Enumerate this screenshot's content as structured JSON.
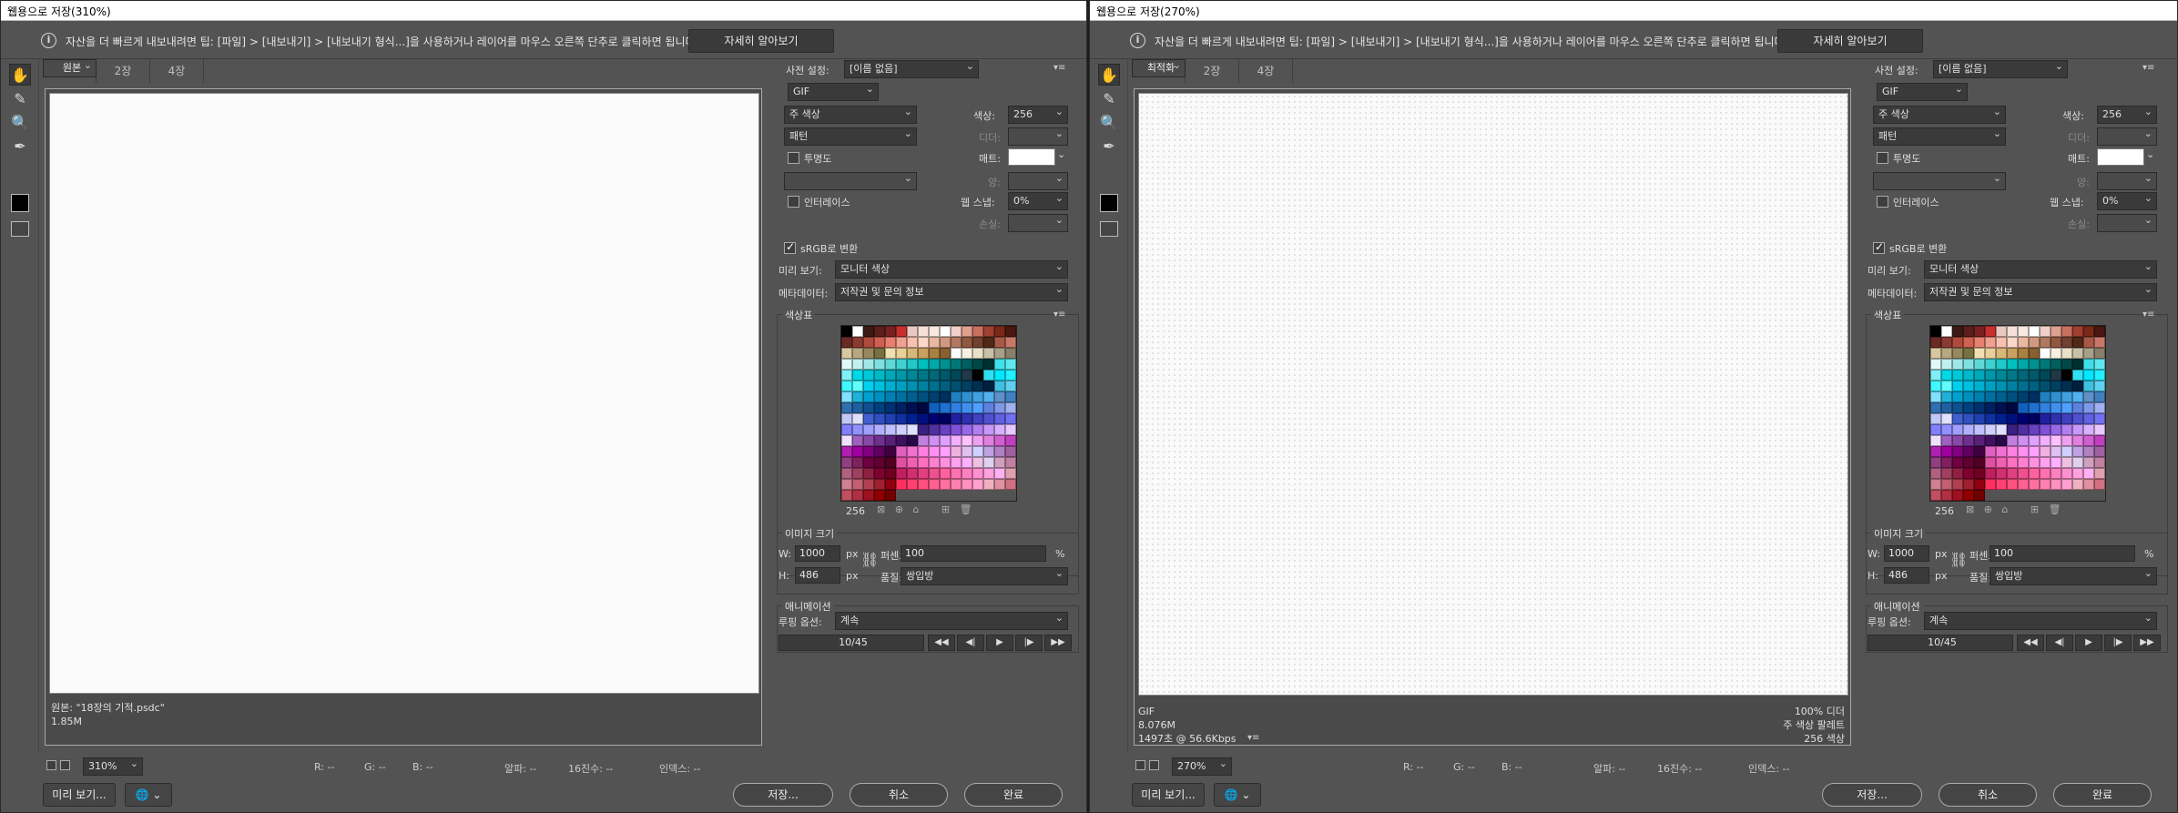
{
  "shared": {
    "tip_icon": "i",
    "tip_text": "자산을 더 빠르게 내보내려면 팁: [파일] > [내보내기] > [내보내기 형식...]을 사용하거나 레이어를 마우스 오른쪽 단추로 클릭하면 됩니다.",
    "learn_more": "자세히 알아보기",
    "tabs": [
      "원본",
      "최적화",
      "2장",
      "4장"
    ],
    "preset_label": "사전 설정:",
    "preset_value": "[이름 없음]",
    "format": "GIF",
    "reduction": "주 색상",
    "colors_label": "색상:",
    "colors_value": "256",
    "dither_algo": "패턴",
    "dither_label": "디더:",
    "transparency_label": "투명도",
    "matte_label": "매트:",
    "amount_label": "양:",
    "interlace_label": "인터레이스",
    "websnap_label": "웹 스냅:",
    "websnap_value": "0%",
    "lossy_label": "손실:",
    "srgb_label": "sRGB로 변환",
    "preview_label": "미리 보기:",
    "preview_value": "모니터 색상",
    "metadata_label": "메타데이터:",
    "metadata_value": "저작권 및 문의 정보",
    "color_table_title": "색상표",
    "color_count": "256",
    "image_size_title": "이미지 크기",
    "w_label": "W:",
    "w_value": "1000",
    "h_label": "H:",
    "h_value": "486",
    "px": "px",
    "percent_label": "퍼센트:",
    "percent_value": "100",
    "percent_unit": "%",
    "quality_label": "품질:",
    "quality_value": "쌍입방",
    "animation_title": "애니메이션",
    "loop_label": "루핑 옵션:",
    "loop_value": "계속",
    "frame_counter": "10/45",
    "anim_buttons": [
      "◀◀",
      "◀|",
      "▶",
      "|▶",
      "▶▶"
    ],
    "r_label": "R: --",
    "g_label": "G: --",
    "b_label": "B: --",
    "alpha_label": "알파: --",
    "hex_label": "16진수: --",
    "index_label": "인덱스: --",
    "preview_btn": "미리 보기...",
    "browser_icon": "🌐",
    "save_btn": "저장...",
    "cancel_btn": "취소",
    "done_btn": "완료"
  },
  "window1": {
    "title": "웹용으로 저장(310%)",
    "zoom": "310%",
    "selected_tab": 0,
    "canvas_info_line1": "원본: \"18장의 기적.psdc\"",
    "canvas_info_line2": "1.85M"
  },
  "window2": {
    "title": "웹용으로 저장(270%)",
    "zoom": "270%",
    "selected_tab": 1,
    "info_left": [
      "GIF",
      "8.076M",
      "1497초 @ 56.6Kbps"
    ],
    "info_right": [
      "100% 디더",
      "주 색상 팔레트",
      "256 색상"
    ]
  },
  "palette_colors": [
    "#000000",
    "#ffffff",
    "#3a1a14",
    "#5a1f1a",
    "#7a2020",
    "#c83030",
    "#e8c8c0",
    "#f4e0d8",
    "#fbe8e0",
    "#ffffff",
    "#f0d0c8",
    "#e0a090",
    "#c87060",
    "#a04030",
    "#7a2818",
    "#4a1810",
    "#6a2a24",
    "#8a3a30",
    "#b04a3c",
    "#d06050",
    "#e88070",
    "#f0a090",
    "#f8c0b0",
    "#fad8c8",
    "#e8b8a0",
    "#d09880",
    "#b07860",
    "#905840",
    "#704030",
    "#502818",
    "#a85848",
    "#c87868",
    "#d8c8a0",
    "#b8a880",
    "#988860",
    "#787040",
    "#f0e0b0",
    "#e8d098",
    "#d8b878",
    "#c8a060",
    "#a88040",
    "#886030",
    "#ffffff",
    "#f8f0e0",
    "#e8e0c8",
    "#c8c0a8",
    "#a8a088",
    "#888068",
    "#e0f8f8",
    "#c0f0f0",
    "#a0e8e8",
    "#80e0e0",
    "#60d8d8",
    "#40d0d0",
    "#20c8c8",
    "#00c0c0",
    "#00a8a8",
    "#009090",
    "#007878",
    "#006060",
    "#004848",
    "#003030",
    "#40e0e8",
    "#60e8f0",
    "#80f0f8",
    "#00d8e8",
    "#00c8d8",
    "#00b8c8",
    "#00a8b8",
    "#0098a8",
    "#008898",
    "#007888",
    "#006878",
    "#005868",
    "#004858",
    "#203848",
    "#000000",
    "#30e0f0",
    "#00e8ff",
    "#20f0ff",
    "#40f8ff",
    "#60ffff",
    "#00d0f0",
    "#00c0e0",
    "#00b0d0",
    "#00a0c0",
    "#0090b0",
    "#0080a0",
    "#007090",
    "#006080",
    "#005070",
    "#004060",
    "#003050",
    "#002040",
    "#40c0e0",
    "#60d0f0",
    "#80e0ff",
    "#20b0d8",
    "#00a0d0",
    "#0090c0",
    "#0080b0",
    "#0070a0",
    "#006090",
    "#005080",
    "#004070",
    "#003060",
    "#2080c0",
    "#3090d0",
    "#40a0e0",
    "#50b0f0",
    "#6090c8",
    "#4080c0",
    "#3070b0",
    "#2060a0",
    "#105090",
    "#004080",
    "#003070",
    "#002060",
    "#001050",
    "#000840",
    "#1060c0",
    "#2070d0",
    "#3080e0",
    "#4090f0",
    "#50a0ff",
    "#6080e0",
    "#8098e8",
    "#a0b0f0",
    "#c0c8f8",
    "#e0e0ff",
    "#4060d0",
    "#3050c0",
    "#2040b0",
    "#1030a0",
    "#002090",
    "#001080",
    "#000070",
    "#000060",
    "#2020a0",
    "#3030b0",
    "#4040c0",
    "#5050d0",
    "#6060e0",
    "#7070f0",
    "#8080ff",
    "#9090ff",
    "#a0a0ff",
    "#b0b0ff",
    "#c0c0ff",
    "#d0d0ff",
    "#e0e0ff",
    "#3a2080",
    "#5030a0",
    "#6840c0",
    "#8050d8",
    "#9868e8",
    "#b080f0",
    "#c898f8",
    "#d8b0ff",
    "#e8c8ff",
    "#f0e0ff",
    "#a060c0",
    "#8848a8",
    "#703090",
    "#582078",
    "#401060",
    "#280848",
    "#c080e0",
    "#d090f0",
    "#e0a0ff",
    "#f0b0ff",
    "#ffc0ff",
    "#f0a0f0",
    "#e080e0",
    "#d060d0",
    "#c040c0",
    "#b020b0",
    "#a000a0",
    "#800080",
    "#600060",
    "#400040",
    "#e060c0",
    "#f070d0",
    "#ff80e0",
    "#ff90f0",
    "#ffa0ff",
    "#f0b0e0",
    "#e0c0f0",
    "#d0d0ff",
    "#c0a0e0",
    "#b080c0",
    "#a060a0",
    "#904080",
    "#802060",
    "#700040",
    "#600030",
    "#500020",
    "#e050a0",
    "#f060b0",
    "#ff70c0",
    "#ff80d0",
    "#ff90e0",
    "#ffa0f0",
    "#ffb0ff",
    "#f0c0e0",
    "#e0d0f0",
    "#d0a0c0",
    "#c080a0",
    "#b06080",
    "#a04060",
    "#902040",
    "#800030",
    "#700020",
    "#c02060",
    "#d03070",
    "#e04080",
    "#f05090",
    "#ff60a0",
    "#ff70b0",
    "#ff80c0",
    "#ff90d0",
    "#ffa0e0",
    "#ffb0f0",
    "#e0a0b0",
    "#d08090",
    "#c06070",
    "#b04050",
    "#a02030",
    "#900010",
    "#ff3060",
    "#ff4070",
    "#ff5080",
    "#ff6090",
    "#ff70a0",
    "#ff80b0",
    "#ff90c0",
    "#ffa0d0",
    "#f0b0c0",
    "#e090a0",
    "#d07080",
    "#c05060",
    "#b03040",
    "#a01020",
    "#900000",
    "#700000"
  ]
}
